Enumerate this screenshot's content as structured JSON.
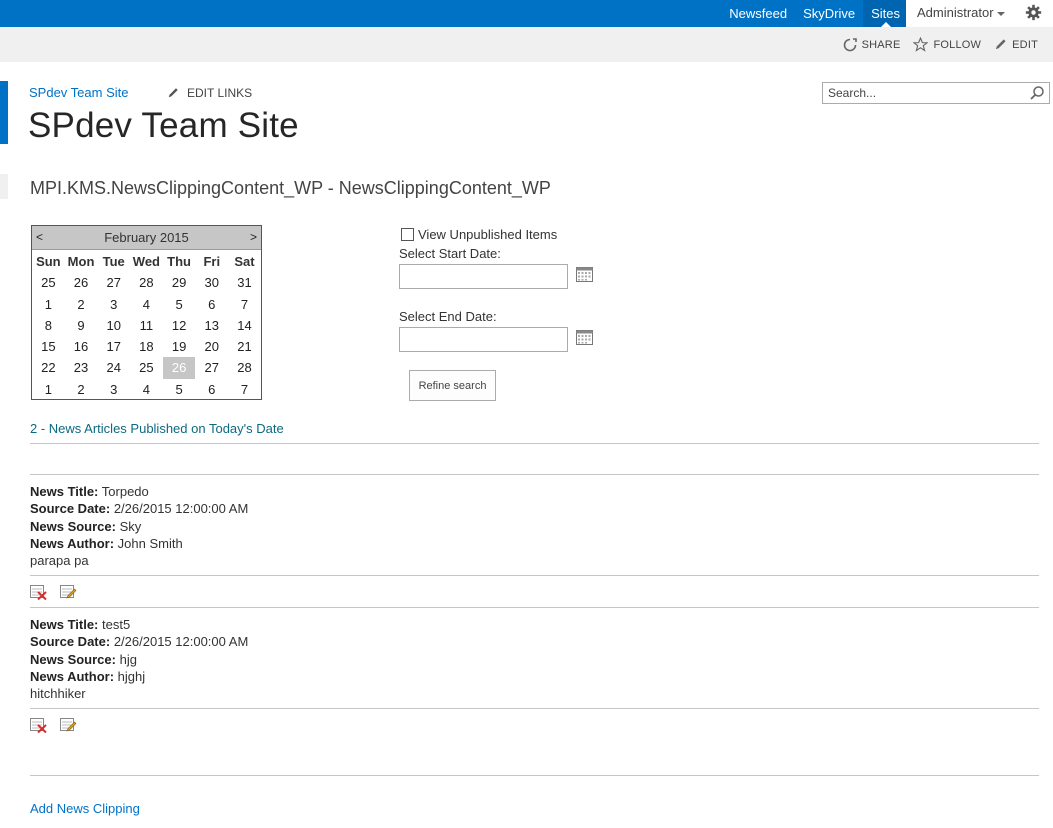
{
  "suite_bar": {
    "links": [
      "Newsfeed",
      "SkyDrive",
      "Sites"
    ],
    "active_link": "Sites",
    "user": "Administrator",
    "accent_color": "#0072c6"
  },
  "ribbon": {
    "share": "SHARE",
    "follow": "FOLLOW",
    "edit": "EDIT"
  },
  "site": {
    "breadcrumb": "SPdev Team Site",
    "edit_links": "EDIT LINKS",
    "title": "SPdev Team Site",
    "search_placeholder": "Search..."
  },
  "webpart": {
    "title": "MPI.KMS.NewsClippingContent_WP - NewsClippingContent_WP"
  },
  "calendar": {
    "prev": "<",
    "next": ">",
    "month": "February 2015",
    "weekdays": [
      "Sun",
      "Mon",
      "Tue",
      "Wed",
      "Thu",
      "Fri",
      "Sat"
    ],
    "weeks": [
      [
        "25",
        "26",
        "27",
        "28",
        "29",
        "30",
        "31"
      ],
      [
        "1",
        "2",
        "3",
        "4",
        "5",
        "6",
        "7"
      ],
      [
        "8",
        "9",
        "10",
        "11",
        "12",
        "13",
        "14"
      ],
      [
        "15",
        "16",
        "17",
        "18",
        "19",
        "20",
        "21"
      ],
      [
        "22",
        "23",
        "24",
        "25",
        "26",
        "27",
        "28"
      ],
      [
        "1",
        "2",
        "3",
        "4",
        "5",
        "6",
        "7"
      ]
    ],
    "today": "26"
  },
  "filters": {
    "view_unpublished": "View Unpublished Items",
    "start_label": "Select Start Date:",
    "start_value": "",
    "end_label": "Select End Date:",
    "end_value": "",
    "refine_button": "Refine search"
  },
  "results": {
    "summary": "2 - News Articles Published on Today's Date",
    "field_labels": {
      "title": "News Title:",
      "date": "Source Date:",
      "source": "News Source:",
      "author": "News Author:"
    },
    "articles": [
      {
        "title": "Torpedo",
        "date": "2/26/2015 12:00:00 AM",
        "source": "Sky",
        "author": "John Smith",
        "body": "parapa pa"
      },
      {
        "title": "test5",
        "date": "2/26/2015 12:00:00 AM",
        "source": "hjg",
        "author": "hjghj",
        "body": "hitchhiker"
      }
    ]
  },
  "footer": {
    "add_link": "Add News Clipping"
  }
}
